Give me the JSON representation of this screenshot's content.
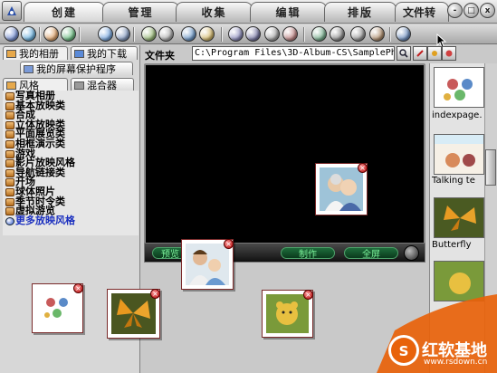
{
  "tabs": [
    {
      "label": "创建",
      "active": true
    },
    {
      "label": "管理",
      "active": false
    },
    {
      "label": "收集",
      "active": false
    },
    {
      "label": "编辑",
      "active": false
    },
    {
      "label": "排版",
      "active": false
    },
    {
      "label": "文件转",
      "active": false
    }
  ],
  "window_buttons": {
    "minimize": "-",
    "maximize": "□",
    "close": "x"
  },
  "toolbar_icons": [
    {
      "name": "gear-icon",
      "color": "#3a5fc0"
    },
    {
      "name": "help-icon",
      "color": "#2a8fd0"
    },
    {
      "name": "album-icon",
      "color": "#d07a2a"
    },
    {
      "name": "globe-icon",
      "color": "#2aa04a"
    },
    {
      "name": "move-icon",
      "color": "#3a7fd0"
    },
    {
      "name": "settings-icon",
      "color": "#4a6aa0"
    },
    {
      "name": "export-icon",
      "color": "#6a9a3a"
    },
    {
      "name": "print-icon",
      "color": "#8a8a8a"
    },
    {
      "name": "share-icon",
      "color": "#2a6ab0"
    },
    {
      "name": "folder-icon",
      "color": "#c09a2a"
    },
    {
      "name": "music-icon",
      "color": "#5a5aa0"
    },
    {
      "name": "camera-icon",
      "color": "#3a3a7a"
    },
    {
      "name": "text-icon",
      "color": "#7a7a7a"
    },
    {
      "name": "frame-icon",
      "color": "#a04a4a"
    },
    {
      "name": "user-icon",
      "color": "#3a8a5a"
    },
    {
      "name": "link-icon",
      "color": "#5a5a5a"
    },
    {
      "name": "type-icon",
      "color": "#6a6a6a"
    },
    {
      "name": "edit-icon",
      "color": "#8a5a2a"
    },
    {
      "name": "web-icon",
      "color": "#2a5aa0"
    }
  ],
  "left_panel": {
    "tab_my_album": "我的相册",
    "tab_my_download": "我的下载",
    "tab_screensaver": "我的屏幕保护程序",
    "tab_style": "风格",
    "tab_mixer": "混合器",
    "styles": [
      "写真相册",
      "基本放映类",
      "合成",
      "立体放映类",
      "平面展览类",
      "相框演示类",
      "游戏",
      "影片放映风格",
      "导航链接类",
      "开场",
      "球体照片",
      "季节时令类",
      "虚拟游览"
    ],
    "more_styles": "更多放映风格"
  },
  "folder": {
    "label": "文件夹",
    "path": "C:\\Program Files\\3D-Album-CS\\SamplePhot"
  },
  "preview_controls": {
    "preview_label": "预览",
    "make_label": "制作",
    "fullscreen_label": "全屏"
  },
  "right_thumbnails": [
    {
      "label": "indexpage."
    },
    {
      "label": "Talking te"
    },
    {
      "label": "Butterfly"
    },
    {
      "label": ""
    }
  ],
  "watermark": {
    "name": "红软基地",
    "url": "www.rsdown.cn"
  }
}
